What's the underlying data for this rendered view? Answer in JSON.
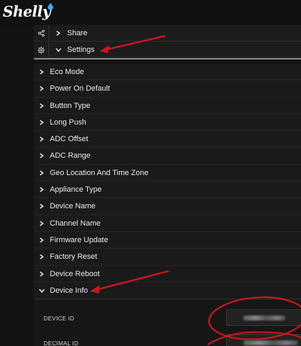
{
  "header": {
    "logo_text": "Shelly",
    "logo_drop_color": "#3fa9f5"
  },
  "actions": [
    {
      "label": "Share",
      "icon": "share-icon",
      "expanded": false
    },
    {
      "label": "Settings",
      "icon": "gear-icon",
      "expanded": true
    }
  ],
  "settings": {
    "items": [
      {
        "label": "Eco Mode"
      },
      {
        "label": "Power On Default"
      },
      {
        "label": "Button Type"
      },
      {
        "label": "Long Push"
      },
      {
        "label": "ADC Offset"
      },
      {
        "label": "ADC Range"
      },
      {
        "label": "Geo Location And Time Zone"
      },
      {
        "label": "Appliance Type"
      },
      {
        "label": "Device Name"
      },
      {
        "label": "Channel Name"
      },
      {
        "label": "Firmware Update"
      },
      {
        "label": "Factory Reset"
      },
      {
        "label": "Device Reboot"
      }
    ],
    "device_info": {
      "label": "Device Info",
      "expanded": true,
      "device_id_label": "DEVICE ID",
      "decimal_id_label": "DECIMAL ID"
    }
  },
  "colors": {
    "background": "#131313",
    "row": "#1a1a1a",
    "text": "#ececec",
    "annotation": "#c8161d"
  }
}
